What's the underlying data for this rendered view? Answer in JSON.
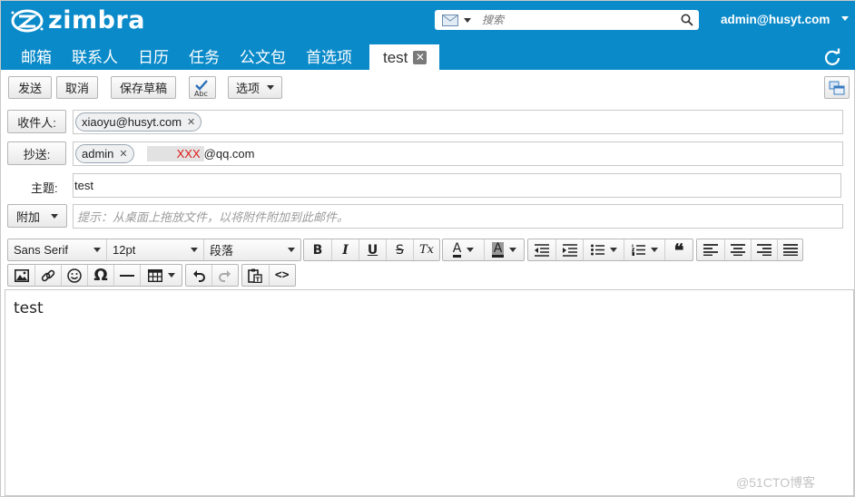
{
  "header": {
    "logo_text": "zimbra",
    "search_placeholder": "搜索",
    "user": "admin@husyt.com",
    "colors": {
      "header_bg": "#0a8ac9",
      "text": "#ffffff"
    }
  },
  "nav": {
    "tabs": [
      "邮箱",
      "联系人",
      "日历",
      "任务",
      "公文包",
      "首选项"
    ],
    "active_tab": "test",
    "refresh_icon": "refresh-icon"
  },
  "toolbar": {
    "send": "发送",
    "cancel": "取消",
    "save_draft": "保存草稿",
    "spellcheck_icon": "spellcheck-abc-icon",
    "spellcheck_text": "Abc",
    "options": "选项",
    "detach_icon": "detach-window-icon"
  },
  "compose": {
    "to_label": "收件人:",
    "to_recipients": [
      "xiaoyu@husyt.com"
    ],
    "cc_label": "抄送:",
    "cc_recipients": [
      "admin"
    ],
    "cc_typed_redacted": "XXX",
    "cc_typed_suffix": "@qq.com",
    "subject_label": "主题:",
    "subject_value": "test",
    "attach_label": "附加",
    "attach_hint": "提示：从桌面上拖放文件，以将附件附加到此邮件。"
  },
  "editor_toolbar": {
    "font_family": "Sans Serif",
    "font_size": "12pt",
    "paragraph": "段落",
    "bold": "B",
    "italic": "I",
    "underline": "U",
    "strike": "S",
    "clear_format": "Tx",
    "font_color": "A",
    "bg_color": "A",
    "quote": "❝",
    "special_char": "Ω",
    "source": "<>"
  },
  "editor": {
    "body": "test"
  },
  "watermark": "@51CTO博客"
}
